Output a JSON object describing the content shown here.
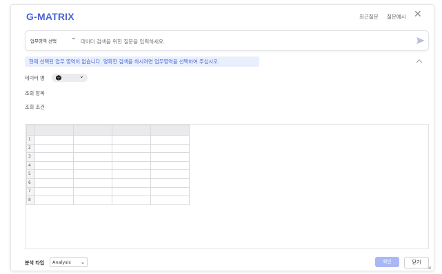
{
  "app": {
    "logo": "G-MATRIX"
  },
  "header": {
    "recent_label": "최근질문",
    "examples_label": "질문예시"
  },
  "search": {
    "area_select": "업무영역 선택",
    "placeholder": "데이터 검색을 위한 질문을 입력하세요."
  },
  "notice": {
    "text": "현재 선택된 업무 영역이 없습니다. 명확한 검색을 하시려면 업무영역을 선택하여 주십시오."
  },
  "fields": {
    "data_name_label": "데이터 명",
    "items_label": "조회 항목",
    "conditions_label": "조회 조건"
  },
  "grid": {
    "row_numbers": [
      "1",
      "2",
      "3",
      "4",
      "5",
      "6",
      "7",
      "8"
    ],
    "column_count": 4
  },
  "footer": {
    "analysis_type_label": "분석 타입",
    "analysis_type_value": "Analysis",
    "confirm_label": "확인",
    "close_label": "닫기"
  },
  "colors": {
    "brand": "#4a63d6",
    "notice_bg": "#e9effd",
    "confirm_bg": "#a9b8f5"
  }
}
